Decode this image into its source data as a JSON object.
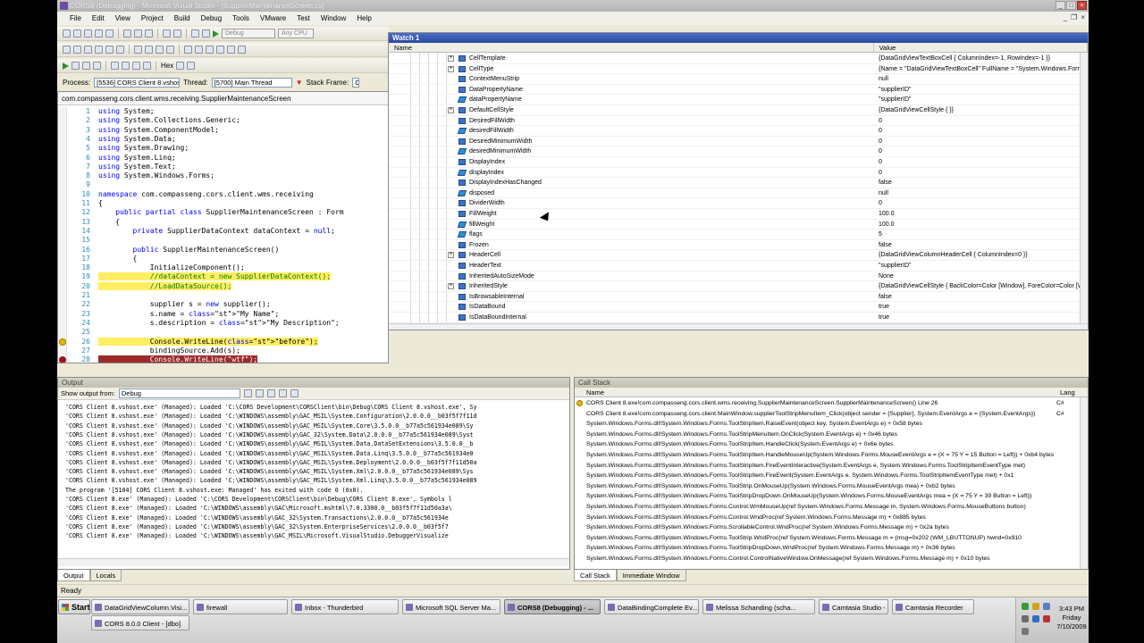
{
  "window": {
    "title": "CORS8 (Debugging) - Microsoft Visual Studio - [SupplierMaintenanceScreen.cs]"
  },
  "menu": [
    "File",
    "Edit",
    "View",
    "Project",
    "Build",
    "Debug",
    "Tools",
    "VMware",
    "Test",
    "Window",
    "Help"
  ],
  "toolbar": {
    "config": "Debug",
    "platform": "Any CPU",
    "hex_label": "Hex"
  },
  "processbar": {
    "process_label": "Process:",
    "process_value": "[5536] CORS Client 8.vshos",
    "thread_label": "Thread:",
    "thread_value": "[5700] Main Thread",
    "stack_label": "Stack Frame:",
    "stack_value": "C"
  },
  "editor": {
    "nav_value": "com.compasseng.cors.client.wms.receiving.SupplierMaintenanceScreen",
    "lines": [
      {
        "n": "1",
        "t": "using System;"
      },
      {
        "n": "2",
        "t": "using System.Collections.Generic;"
      },
      {
        "n": "3",
        "t": "using System.ComponentModel;"
      },
      {
        "n": "4",
        "t": "using System.Data;"
      },
      {
        "n": "5",
        "t": "using System.Drawing;"
      },
      {
        "n": "6",
        "t": "using System.Linq;"
      },
      {
        "n": "7",
        "t": "using System.Text;"
      },
      {
        "n": "8",
        "t": "using System.Windows.Forms;"
      },
      {
        "n": "9",
        "t": ""
      },
      {
        "n": "10",
        "t": "namespace com.compasseng.cors.client.wms.receiving"
      },
      {
        "n": "11",
        "t": "{"
      },
      {
        "n": "12",
        "t": "    public partial class SupplierMaintenanceScreen : Form"
      },
      {
        "n": "13",
        "t": "    {"
      },
      {
        "n": "14",
        "t": "        private SupplierDataContext dataContext = null;"
      },
      {
        "n": "15",
        "t": ""
      },
      {
        "n": "16",
        "t": "        public SupplierMaintenanceScreen()"
      },
      {
        "n": "17",
        "t": "        {"
      },
      {
        "n": "18",
        "t": "            InitializeComponent();"
      },
      {
        "n": "19",
        "t": "            //dataContext = new SupplierDataContext();"
      },
      {
        "n": "20",
        "t": "            //LoadDataSource();"
      },
      {
        "n": "21",
        "t": ""
      },
      {
        "n": "22",
        "t": "            supplier s = new supplier();"
      },
      {
        "n": "23",
        "t": "            s.name = \"My Name\";"
      },
      {
        "n": "24",
        "t": "            s.description = \"My Description\";"
      },
      {
        "n": "25",
        "t": ""
      },
      {
        "n": "26",
        "t": "            Console.WriteLine(\"before\");"
      },
      {
        "n": "27",
        "t": "            bindingSource.Add(s);"
      },
      {
        "n": "28",
        "t": "            Console.WriteLine(\"wtf\");"
      }
    ]
  },
  "watch": {
    "title": "Watch 1",
    "col_name": "Name",
    "col_value": "Value",
    "rows": [
      {
        "name": "CellTemplate",
        "value": "{DataGridViewTextBoxCell { ColumnIndex=-1, RowIndex=-1 }}",
        "exp": true,
        "field": false
      },
      {
        "name": "CellType",
        "value": "{Name = \"DataGridViewTextBoxCell\" FullName = \"System.Windows.Forms.DataGridViewTextBoxCell\"}",
        "exp": true,
        "field": false
      },
      {
        "name": "ContextMenuStrip",
        "value": "null",
        "exp": false,
        "field": false
      },
      {
        "name": "DataPropertyName",
        "value": "\"supplierID\"",
        "exp": false,
        "field": false
      },
      {
        "name": "dataPropertyName",
        "value": "\"supplierID\"",
        "exp": false,
        "field": true
      },
      {
        "name": "DefaultCellStyle",
        "value": "{DataGridViewCellStyle { }}",
        "exp": true,
        "field": false
      },
      {
        "name": "DesiredFillWidth",
        "value": "0",
        "exp": false,
        "field": false
      },
      {
        "name": "desiredFillWidth",
        "value": "0",
        "exp": false,
        "field": true
      },
      {
        "name": "DesiredMinimumWidth",
        "value": "0",
        "exp": false,
        "field": false
      },
      {
        "name": "desiredMinimumWidth",
        "value": "0",
        "exp": false,
        "field": true
      },
      {
        "name": "DisplayIndex",
        "value": "0",
        "exp": false,
        "field": false
      },
      {
        "name": "displayIndex",
        "value": "0",
        "exp": false,
        "field": true
      },
      {
        "name": "DisplayIndexHasChanged",
        "value": "false",
        "exp": false,
        "field": false
      },
      {
        "name": "disposed",
        "value": "null",
        "exp": false,
        "field": true
      },
      {
        "name": "DividerWidth",
        "value": "0",
        "exp": false,
        "field": false
      },
      {
        "name": "FillWeight",
        "value": "100.0",
        "exp": false,
        "field": false
      },
      {
        "name": "fillWeight",
        "value": "100.0",
        "exp": false,
        "field": true
      },
      {
        "name": "flags",
        "value": "5",
        "exp": false,
        "field": true
      },
      {
        "name": "Frozen",
        "value": "false",
        "exp": false,
        "field": false
      },
      {
        "name": "HeaderCell",
        "value": "{DataGridViewColumnHeaderCell { ColumnIndex=0 }}",
        "exp": true,
        "field": false
      },
      {
        "name": "HeaderText",
        "value": "\"supplierID\"",
        "exp": false,
        "field": false
      },
      {
        "name": "InheritedAutoSizeMode",
        "value": "None",
        "exp": false,
        "field": false
      },
      {
        "name": "InheritedStyle",
        "value": "{DataGridViewCellStyle { BackColor=Color [Window], ForeColor=Color [WindowText] }}",
        "exp": true,
        "field": false
      },
      {
        "name": "IsBrowsableInternal",
        "value": "false",
        "exp": false,
        "field": false
      },
      {
        "name": "IsDataBound",
        "value": "true",
        "exp": false,
        "field": false
      },
      {
        "name": "IsDataBoundInternal",
        "value": "true",
        "exp": false,
        "field": false
      }
    ]
  },
  "output": {
    "title": "Output",
    "show_label": "Show output from:",
    "source": "Debug",
    "lines": [
      "'CORS Client 8.vshost.exe' (Managed): Loaded 'C:\\CORS Development\\CORSClient\\bin\\Debug\\CORS Client 8.vshost.exe', Sy",
      "'CORS Client 8.vshost.exe' (Managed): Loaded 'C:\\WINDOWS\\assembly\\GAC_MSIL\\System.Configuration\\2.0.0.0__b03f5f7f11d",
      "'CORS Client 8.vshost.exe' (Managed): Loaded 'C:\\WINDOWS\\assembly\\GAC_MSIL\\System.Core\\3.5.0.0__b77a5c561934e089\\Sy",
      "'CORS Client 8.vshost.exe' (Managed): Loaded 'C:\\WINDOWS\\assembly\\GAC_32\\System.Data\\2.0.0.0__b77a5c561934e089\\Syst",
      "'CORS Client 8.vshost.exe' (Managed): Loaded 'C:\\WINDOWS\\assembly\\GAC_MSIL\\System.Data.DataSetExtensions\\3.5.0.0__b",
      "'CORS Client 8.vshost.exe' (Managed): Loaded 'C:\\WINDOWS\\assembly\\GAC_MSIL\\System.Data.Linq\\3.5.0.0__b77a5c561934e0",
      "'CORS Client 8.vshost.exe' (Managed): Loaded 'C:\\WINDOWS\\assembly\\GAC_MSIL\\System.Deployment\\2.0.0.0__b03f5f7f11d50a",
      "'CORS Client 8.vshost.exe' (Managed): Loaded 'C:\\WINDOWS\\assembly\\GAC_MSIL\\System.Xml\\2.0.0.0__b77a5c561934e089\\Sys",
      "'CORS Client 8.vshost.exe' (Managed): Loaded 'C:\\WINDOWS\\assembly\\GAC_MSIL\\System.Xml.Linq\\3.5.0.0__b77a5c561934e089",
      "The program '[5104] CORS Client 8.vshost.exe: Managed' has exited with code 0 (0x0).",
      "'CORS Client 8.exe' (Managed): Loaded 'C:\\CORS Development\\CORSClient\\bin\\Debug\\CORS Client 8.exe', Symbols l",
      "'CORS Client 8.exe' (Managed): Loaded 'C:\\WINDOWS\\assembly\\GAC\\Microsoft.mshtml\\7.0.3300.0__b03f5f7f11d50a3a\\",
      "'CORS Client 8.exe' (Managed): Loaded 'C:\\WINDOWS\\assembly\\GAC_32\\System.Transactions\\2.0.0.0__b77a5c561934e",
      "'CORS Client 8.exe' (Managed): Loaded 'C:\\WINDOWS\\assembly\\GAC_32\\System.EnterpriseServices\\2.0.0.0__b03f5f7",
      "'CORS Client 8.exe' (Managed): Loaded 'C:\\WINDOWS\\assembly\\GAC_MSIL\\Microsoft.VisualStudio.DebuggerVisualize"
    ],
    "tab_output": "Output",
    "tab_locals": "Locals"
  },
  "callstack": {
    "title": "Call Stack",
    "col_name": "Name",
    "col_lang": "Lang",
    "rows": [
      {
        "name": "CORS Client 8.exe!com.compasseng.cors.client.wms.receiving.SupplierMaintenanceScreen.SupplierMaintenanceScreen() Line 26",
        "lang": "C#",
        "current": true
      },
      {
        "name": "CORS Client 8.exe!com.compasseng.cors.client.MainWindow.supplierToolStripMenuItem_Click(object sender = {Supplier}, System.EventArgs e = {System.EventArgs})",
        "lang": "C#",
        "current": false
      },
      {
        "name": "System.Windows.Forms.dll!System.Windows.Forms.ToolStripItem.RaiseEvent(object key, System.EventArgs e) + 0x58 bytes",
        "lang": "",
        "current": false
      },
      {
        "name": "System.Windows.Forms.dll!System.Windows.Forms.ToolStripMenuItem.OnClick(System.EventArgs e) + 0x46 bytes",
        "lang": "",
        "current": false
      },
      {
        "name": "System.Windows.Forms.dll!System.Windows.Forms.ToolStripItem.HandleClick(System.EventArgs e) + 0x6e bytes",
        "lang": "",
        "current": false
      },
      {
        "name": "System.Windows.Forms.dll!System.Windows.Forms.ToolStripItem.HandleMouseUp(System.Windows.Forms.MouseEventArgs e = {X = 75 Y = 15 Button = Left}) + 0xb4 bytes",
        "lang": "",
        "current": false
      },
      {
        "name": "System.Windows.Forms.dll!System.Windows.Forms.ToolStripItem.FireEventInteractive(System.EventArgs e, System.Windows.Forms.ToolStripItemEventType met)",
        "lang": "",
        "current": false
      },
      {
        "name": "System.Windows.Forms.dll!System.Windows.Forms.ToolStripItem.FireEvent(System.EventArgs e, System.Windows.Forms.ToolStripItemEventType met) + 0x1",
        "lang": "",
        "current": false
      },
      {
        "name": "System.Windows.Forms.dll!System.Windows.Forms.ToolStrip.OnMouseUp(System.Windows.Forms.MouseEventArgs mea) + 0xb2 bytes",
        "lang": "",
        "current": false
      },
      {
        "name": "System.Windows.Forms.dll!System.Windows.Forms.ToolStripDropDown.OnMouseUp(System.Windows.Forms.MouseEventArgs mea = {X = 75 Y = 39 Button = Left})",
        "lang": "",
        "current": false
      },
      {
        "name": "System.Windows.Forms.dll!System.Windows.Forms.Control.WmMouseUp(ref System.Windows.Forms.Message m, System.Windows.Forms.MouseButtons button)",
        "lang": "",
        "current": false
      },
      {
        "name": "System.Windows.Forms.dll!System.Windows.Forms.Control.WndProc(ref System.Windows.Forms.Message m) + 0x885 bytes",
        "lang": "",
        "current": false
      },
      {
        "name": "System.Windows.Forms.dll!System.Windows.Forms.ScrollableControl.WndProc(ref System.Windows.Forms.Message m) + 0x2a bytes",
        "lang": "",
        "current": false
      },
      {
        "name": "System.Windows.Forms.dll!System.Windows.Forms.ToolStrip.WndProc(ref System.Windows.Forms.Message m = {msg=0x202 (WM_LBUTTONUP) hwnd=0x910",
        "lang": "",
        "current": false
      },
      {
        "name": "System.Windows.Forms.dll!System.Windows.Forms.ToolStripDropDown.WndProc(ref System.Windows.Forms.Message m) + 0x36 bytes",
        "lang": "",
        "current": false
      },
      {
        "name": "System.Windows.Forms.dll!System.Windows.Forms.Control.ControlNativeWindow.OnMessage(ref System.Windows.Forms.Message m) + 0x10 bytes",
        "lang": "",
        "current": false
      }
    ],
    "tab_callstack": "Call Stack",
    "tab_immediate": "Immediate Window"
  },
  "status": {
    "text": "Ready"
  },
  "taskbar": {
    "start": "Start",
    "items": [
      {
        "label": "DataGridViewColumn.Visi...",
        "active": false
      },
      {
        "label": "firewall",
        "active": false
      },
      {
        "label": "Inbox - Thunderbird",
        "active": false
      },
      {
        "label": "Microsoft SQL Server Ma...",
        "active": false
      },
      {
        "label": "CORS8 (Debugging) - ...",
        "active": true
      },
      {
        "label": "DataBindingComplete Ev...",
        "active": false
      },
      {
        "label": "Melissa Schanding (scha...",
        "active": false
      },
      {
        "label": "Camtasia Studio - Untitle...",
        "active": false
      },
      {
        "label": "Camtasia Recorder",
        "active": false
      },
      {
        "label": "CORS 8.0.0 Client - [dbo]",
        "active": false
      }
    ],
    "clock_time": "3:43 PM",
    "clock_day": "Friday",
    "clock_date": "7/10/2009"
  },
  "colors": {
    "accent": "#2b4aa0",
    "keyword": "#0000ff",
    "type": "#2b91af",
    "string": "#a31515",
    "comment": "#008000",
    "highlight": "#ffee62",
    "breakpoint": "#9c2a2a"
  }
}
